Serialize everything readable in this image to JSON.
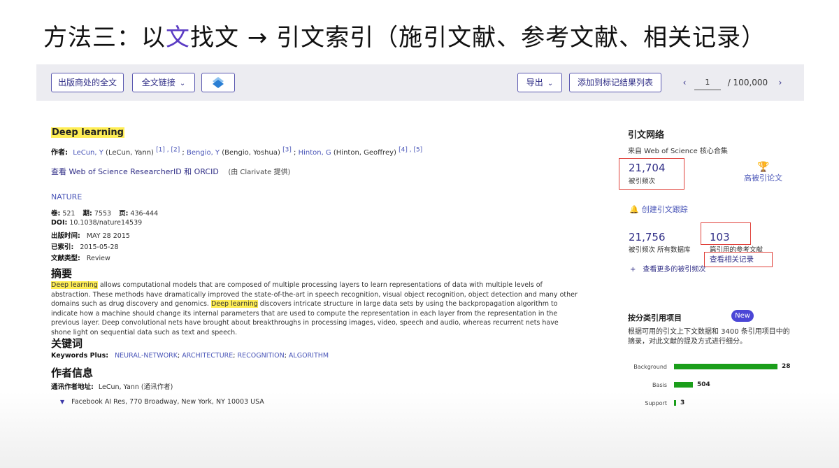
{
  "slide": {
    "title_pre": "方法三：以",
    "title_hl": "文",
    "title_post": "找文 → 引文索引（施引文献、参考文献、相关记录）"
  },
  "toolbar": {
    "publisher_full_text": "出版商处的全文",
    "full_text_links": "全文链接",
    "export": "导出",
    "add_to_marked": "添加到标记结果列表",
    "page_current": "1",
    "page_total": "/ 100,000"
  },
  "article": {
    "title": "Deep learning",
    "authors_label": "作者:",
    "authors": [
      {
        "name": "LeCun, Y",
        "full": "(LeCun, Yann)",
        "refs": "[1] , [2]"
      },
      {
        "name": "Bengio, Y",
        "full": "(Bengio, Yoshua)",
        "refs": "[3]"
      },
      {
        "name": "Hinton, G",
        "full": "(Hinton, Geoffrey)",
        "refs": "[4] , [5]"
      }
    ],
    "researcher_link": "查看 Web of Science ResearcherID 和 ORCID",
    "provided_by": "(由 Clarivate 提供)",
    "journal": "NATURE",
    "meta": {
      "volume_label": "卷:",
      "volume": "521",
      "issue_label": "期:",
      "issue": "7553",
      "pages_label": "页:",
      "pages": "436-444",
      "doi_label": "DOI:",
      "doi": "10.1038/nature14539",
      "pubdate_label": "出版时间:",
      "pubdate": "MAY 28 2015",
      "indexed_label": "已索引:",
      "indexed": "2015-05-28",
      "doctype_label": "文献类型:",
      "doctype": "Review"
    },
    "abstract_heading": "摘要",
    "abstract_hl1": "Deep learning",
    "abstract_part1": " allows computational models that are composed of multiple processing layers to learn representations of data with multiple levels of abstraction. These methods have dramatically improved the state-of-the-art in speech recognition, visual object recognition, object detection and many other domains such as drug discovery and genomics. ",
    "abstract_hl2": "Deep learning",
    "abstract_part2": " discovers intricate structure in large data sets by using the backpropagation algorithm to indicate how a machine should change its internal parameters that are used to compute the representation in each layer from the representation in the previous layer. Deep convolutional nets have brought about breakthroughs in processing images, video, speech and audio, whereas recurrent nets have shone light on sequential data such as text and speech.",
    "keywords_heading": "关键词",
    "keywords_label": "Keywords Plus:",
    "keywords": [
      "NEURAL-NETWORK",
      "ARCHITECTURE",
      "RECOGNITION",
      "ALGORITHM"
    ],
    "author_info_heading": "作者信息",
    "corresponding_label": "通讯作者地址:",
    "corresponding": "LeCun, Yann (通讯作者)",
    "organization": "Facebook AI Res, 770 Broadway, New York, NY 10003 USA"
  },
  "citation_network": {
    "heading": "引文网络",
    "source": "来自 Web of Science 核心合集",
    "times_cited": "21,704",
    "times_cited_label": "被引频次",
    "highly_cited": "高被引论文",
    "create_alert": "创建引文跟踪",
    "all_db_cited": "21,756",
    "all_db_label": "被引频次 所有数据库",
    "references": "103",
    "references_label": "篇引用的参考文献",
    "related_records": "查看相关记录",
    "see_more": "查看更多的被引频次"
  },
  "classification": {
    "heading": "按分类引用项目",
    "badge": "New",
    "description": "根据可用的引文上下文数据和 3400 条引用项目中的摘录，对此文献的提及方式进行细分。",
    "bars": [
      {
        "label": "Background",
        "value": "28",
        "fraction": 1.0
      },
      {
        "label": "Basis",
        "value": "504",
        "fraction": 0.18
      },
      {
        "label": "Support",
        "value": "3",
        "fraction": 0.02
      }
    ]
  }
}
